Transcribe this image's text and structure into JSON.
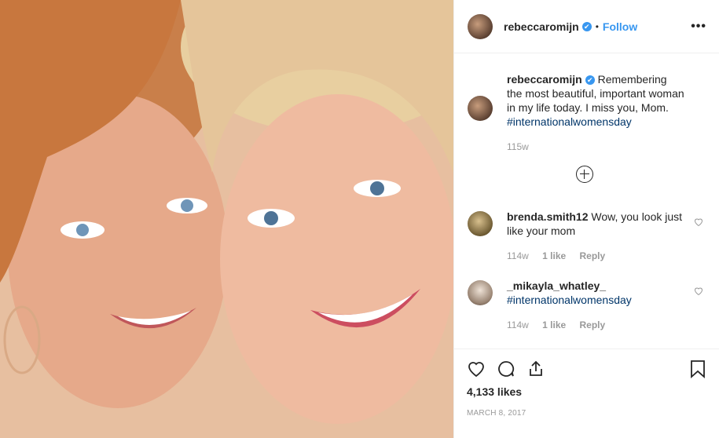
{
  "post": {
    "username": "rebeccaromijn",
    "verified_mark": "✔",
    "dot": "•",
    "follow_label": "Follow",
    "more_label": "•••"
  },
  "caption": {
    "username": "rebeccaromijn",
    "text": "Remembering the most beautiful, important woman in my life today. I miss you, Mom.",
    "hashtag": "#internationalwomensday",
    "time": "115w"
  },
  "comments": [
    {
      "username": "brenda.smith12",
      "text": "Wow, you look just like your mom",
      "time": "114w",
      "likes": "1 like",
      "reply": "Reply"
    },
    {
      "username": "_mikayla_whatley_",
      "text": "#internationalwomensday",
      "time": "114w",
      "likes": "1 like",
      "reply": "Reply"
    }
  ],
  "likes_count": "4,133 likes",
  "date": "MARCH 8, 2017",
  "icons": [
    "heart-icon",
    "comment-icon",
    "share-icon",
    "bookmark-icon",
    "add-more-comments-icon",
    "like-comment-icon"
  ],
  "colors": {
    "link": "#3897f0",
    "hashtag": "#003569",
    "muted": "#999999"
  }
}
